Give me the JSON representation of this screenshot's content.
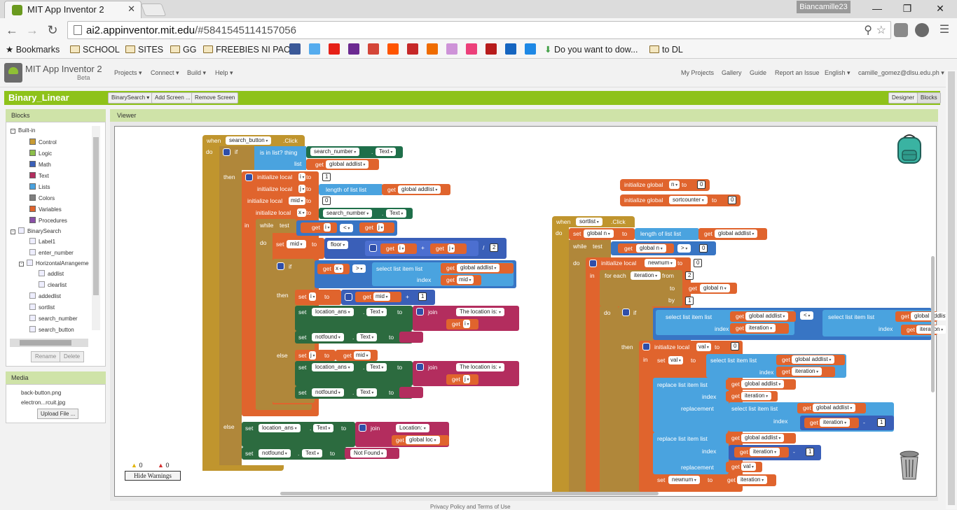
{
  "browser": {
    "tab_title": "MIT App Inventor 2",
    "tab_close": "✕",
    "user_label": "Biancamille23",
    "url_host": "ai2.appinventor.mit.edu",
    "url_path": "/#5841545114157056",
    "bookmarks": [
      "Bookmarks",
      "SCHOOL",
      "SITES",
      "GG",
      "FREEBIES NI PAO",
      "Do you want to dow...",
      "to DL"
    ]
  },
  "app": {
    "title": "MIT App Inventor 2",
    "beta": "Beta",
    "menus": [
      "Projects ▾",
      "Connect ▾",
      "Build ▾",
      "Help ▾"
    ],
    "right_menus": [
      "My Projects",
      "Gallery",
      "Guide",
      "Report an Issue",
      "English ▾",
      "camille_gomez@dlsu.edu.ph ▾"
    ],
    "project_name": "Binary_Linear",
    "project_buttons": [
      "BinarySearch ▾",
      "Add Screen ...",
      "Remove Screen"
    ],
    "mode_buttons": [
      "Designer",
      "Blocks"
    ]
  },
  "blocks_panel": {
    "title": "Blocks",
    "builtin": "Built-in",
    "builtin_items": [
      "Control",
      "Logic",
      "Math",
      "Text",
      "Lists",
      "Colors",
      "Variables",
      "Procedures"
    ],
    "builtin_colors": [
      "#c89b34",
      "#8cbf4a",
      "#3a5fb8",
      "#b32d5e",
      "#4aa3df",
      "#7f7f7f",
      "#e0642d",
      "#8a4fa8"
    ],
    "screen": "BinarySearch",
    "components": [
      "Label1",
      "enter_number",
      "HorizontalArrangeme",
      "addlist",
      "clearlist",
      "addedlist",
      "sortlist",
      "search_number",
      "search_button"
    ],
    "rename": "Rename",
    "delete": "Delete"
  },
  "media_panel": {
    "title": "Media",
    "files": [
      "back-button.png",
      "electron...rcuit.jpg"
    ],
    "upload": "Upload File ..."
  },
  "viewer": {
    "title": "Viewer",
    "warnings": "0",
    "errors": "0",
    "hide_warnings": "Hide Warnings",
    "footer": "Privacy Policy and Terms of Use"
  },
  "blocks": {
    "when": "when",
    "do": "do",
    "click": ".Click",
    "if": "if",
    "then": "then",
    "else": "else",
    "while": "while",
    "test": "test",
    "to": "to",
    "set": "set",
    "get": "get",
    "join": "join",
    "list": "list",
    "index": "index",
    "from": "from",
    "by": "by",
    "in": "in",
    "text_prop": "Text",
    "initialize_local": "initialize local",
    "initialize_global": "initialize global",
    "is_in_list": "is in list? thing",
    "length_of_list": "length of list  list",
    "select_list_item": "select list item  list",
    "replace_list_item": "replace list item  list",
    "replacement": "replacement",
    "for_each": "for each",
    "floor": "floor",
    "search_button": "search_button",
    "sortlist": "sortlist",
    "search_number": "search_number",
    "global_addlist": "global addlist",
    "global_loc": "global loc",
    "global_n": "global n",
    "var_i": "i",
    "var_j": "j",
    "var_mid": "mid",
    "var_x": "x",
    "var_n": "n",
    "var_sortcounter": "sortcounter",
    "var_newnum": "newnum",
    "var_iteration": "iteration",
    "var_val": "val",
    "location_ans": "location_ans",
    "notfound": "notfound",
    "str_location_is": " The location is: ",
    "str_location": " Location: ",
    "str_not_found": "Not Found",
    "n0": "0",
    "n1": "1",
    "n2": "2",
    "op_lt": "<",
    "op_gt": ">",
    "op_plus": "+",
    "op_div": "/",
    "op_minus": "-"
  }
}
